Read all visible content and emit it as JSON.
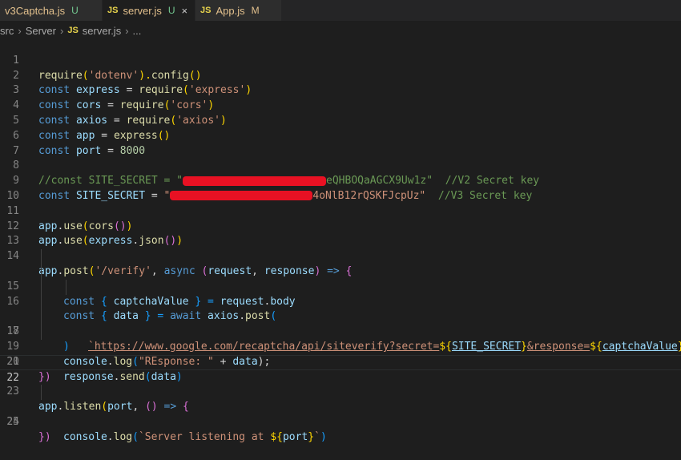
{
  "tabs": [
    {
      "name": "v3Captcha.js",
      "badge": "U",
      "lang": ""
    },
    {
      "name": "server.js",
      "badge": "U",
      "lang": "JS",
      "close": "×"
    },
    {
      "name": "App.js",
      "badge": "M",
      "lang": "JS"
    }
  ],
  "breadcrumb": {
    "part1": "src",
    "part2": "Server",
    "lang": "JS",
    "file": "server.js",
    "ellipsis": "..."
  },
  "lines": {
    "l1": {
      "n": "1",
      "a": "require",
      "b": "(",
      "c": "'dotenv'",
      "d": ").",
      "e": "config",
      "f": "()"
    },
    "l2": {
      "n": "2",
      "a": "const",
      "b": "express",
      "c": " = ",
      "d": "require",
      "e": "(",
      "f": "'express'",
      "g": ")"
    },
    "l3": {
      "n": "3",
      "a": "const",
      "b": "cors",
      "c": " = ",
      "d": "require",
      "e": "(",
      "f": "'cors'",
      "g": ")"
    },
    "l4": {
      "n": "4",
      "a": "const",
      "b": "axios",
      "c": " = ",
      "d": "require",
      "e": "(",
      "f": "'axios'",
      "g": ")"
    },
    "l5": {
      "n": "5",
      "a": "const",
      "b": "app",
      "c": " = ",
      "d": "express",
      "e": "()"
    },
    "l6": {
      "n": "6",
      "a": "const",
      "b": "port",
      "c": " = ",
      "d": "8000"
    },
    "l7": {
      "n": "7"
    },
    "l8": {
      "n": "8",
      "a": "//const SITE_SECRET = \"",
      "b": "eQHBOQaAGCX9Uw1z\"  //V2 Secret key"
    },
    "l9": {
      "n": "9",
      "a": "const",
      "b": "SITE_SECRET",
      "c": " = ",
      "d": "\"",
      "e": "4oNlB12rQSKFJcpUz\"",
      "f": "  //V3 Secret key"
    },
    "l10": {
      "n": "10"
    },
    "l11": {
      "n": "11",
      "a": "app",
      "b": ".",
      "c": "use",
      "d": "(",
      "e": "cors",
      "f": "()",
      "g": ")"
    },
    "l12": {
      "n": "12",
      "a": "app",
      "b": ".",
      "c": "use",
      "d": "(",
      "e": "express",
      "f": ".",
      "g": "json",
      "h": "()",
      "i": ")"
    },
    "l13": {
      "n": "13"
    },
    "l14": {
      "n": "14",
      "a": "app",
      "b": ".",
      "c": "post",
      "d": "(",
      "e": "'/verify'",
      "f": ", ",
      "g": "async",
      "h": " ",
      "i": "(",
      "j": "request",
      "k": ", ",
      "l": "response",
      "m": ")",
      "o": " => ",
      "p": "{"
    },
    "l15": {
      "n": "15",
      "a": "const",
      "b": " { ",
      "c": "captchaValue",
      "d": " } = ",
      "e": "request",
      "f": ".",
      "g": "body"
    },
    "l16": {
      "n": "16",
      "a": "const",
      "b": " { ",
      "c": "data",
      "d": " } = ",
      "e": "await",
      "f": " ",
      "g": "axios",
      "h": ".",
      "i": "post",
      "j": "("
    },
    "l17": {
      "n": "17",
      "a": "`https://www.google.com/recaptcha/api/siteverify?secret=",
      "b": "${",
      "c": "SITE_SECRET",
      "d": "}",
      "e": "&response=",
      "f": "${",
      "g": "captchaValue",
      "h": "}",
      "i": "`",
      "j": ","
    },
    "l18": {
      "n": "18",
      "a": ")"
    },
    "l19": {
      "n": "19",
      "a": "console",
      "b": ".",
      "c": "log",
      "d": "(",
      "e": "\"REsponse: \"",
      "f": " + ",
      "g": "data",
      "h": ");"
    },
    "l20": {
      "n": "20",
      "a": "response",
      "b": ".",
      "c": "send",
      "d": "(",
      "e": "data",
      "f": ")"
    },
    "l21": {
      "n": "21",
      "a": "})"
    },
    "l22": {
      "n": "22"
    },
    "l23": {
      "n": "23",
      "a": "app",
      "b": ".",
      "c": "listen",
      "d": "(",
      "e": "port",
      "f": ", ",
      "g": "()",
      "h": " => ",
      "i": "{"
    },
    "l24": {
      "n": "24",
      "a": "console",
      "b": ".",
      "c": "log",
      "d": "(",
      "e": "`Server listening at ",
      "f": "${",
      "g": "port",
      "h": "}",
      "i": "`",
      "j": ")"
    },
    "l25": {
      "n": "25",
      "a": "})"
    }
  },
  "colors": {
    "background": "#1e1e1e",
    "keyword": "#569cd6",
    "function": "#dcdcaa",
    "string": "#ce9178",
    "variable": "#9cdcfe",
    "number": "#b5cea8",
    "comment": "#6a9955",
    "redaction": "#e81123"
  }
}
